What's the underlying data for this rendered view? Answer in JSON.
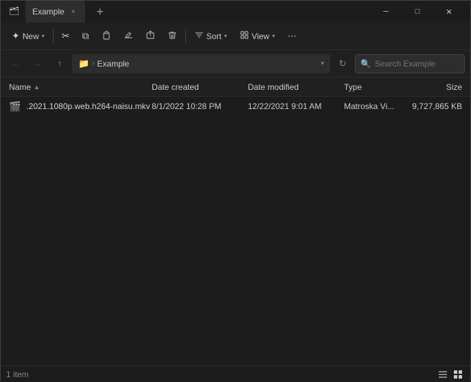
{
  "titlebar": {
    "icon": "🗂",
    "tab_label": "Example",
    "close_tab_label": "×",
    "new_tab_label": "+",
    "minimize_label": "─",
    "maximize_label": "□",
    "close_label": "✕"
  },
  "toolbar": {
    "new_label": "New",
    "cut_icon": "✂",
    "copy_icon": "⧉",
    "paste_icon": "📋",
    "rename_icon": "✏",
    "share_icon": "↗",
    "delete_icon": "🗑",
    "sort_label": "Sort",
    "view_label": "View",
    "more_icon": "•••"
  },
  "addressbar": {
    "back_icon": "←",
    "forward_icon": "→",
    "up_icon": "↑",
    "folder_icon": "📁",
    "breadcrumb_root": ">",
    "breadcrumb_folder": "Example",
    "refresh_icon": "↻",
    "search_placeholder": "Search Example"
  },
  "file_list": {
    "columns": {
      "name": "Name",
      "date_created": "Date created",
      "date_modified": "Date modified",
      "type": "Type",
      "size": "Size"
    },
    "files": [
      {
        "icon": "🎬",
        "name": ".2021.1080p.web.h264-naisu.mkv",
        "name_prefix": "████████████",
        "date_created": "8/1/2022 10:28 PM",
        "date_modified": "12/22/2021 9:01 AM",
        "type": "Matroska Vi...",
        "size": "9,727,865 KB"
      }
    ]
  },
  "statusbar": {
    "count_label": "1 item",
    "details_icon": "≡",
    "grid_icon": "⊞"
  }
}
